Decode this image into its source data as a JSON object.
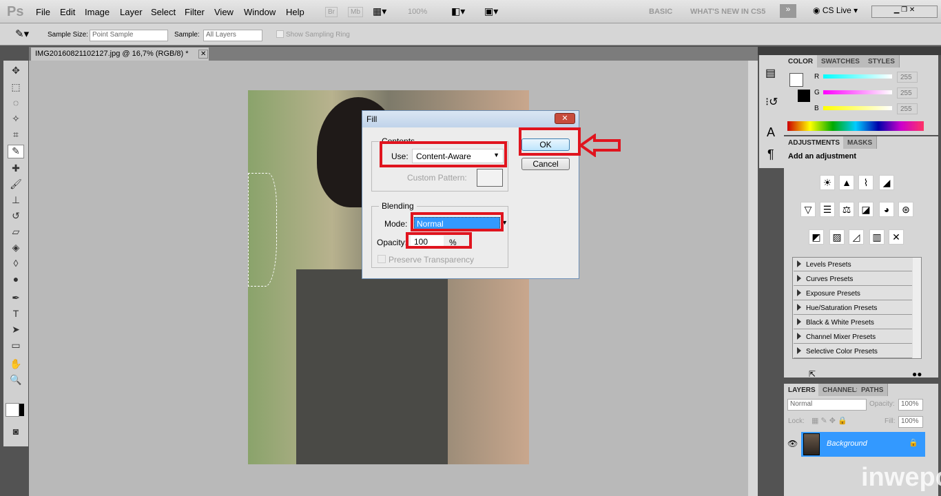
{
  "app": {
    "logo": "Ps",
    "menus": [
      "File",
      "Edit",
      "Image",
      "Layer",
      "Select",
      "Filter",
      "View",
      "Window",
      "Help"
    ],
    "bridge": "Br",
    "minibridge": "Mb",
    "zoom": "100%",
    "workspace_basic": "BASIC",
    "workspace_new": "WHAT'S NEW IN CS5",
    "cslive": "CS Live"
  },
  "options": {
    "sample_size_label": "Sample Size:",
    "sample_size": "Point Sample",
    "sample_label": "Sample:",
    "sample": "All Layers",
    "show_ring": "Show Sampling Ring"
  },
  "document": {
    "tab": "IMG20160821102127.jpg @ 16,7% (RGB/8) *"
  },
  "dialog": {
    "title": "Fill",
    "contents_legend": "Contents",
    "use_label": "Use:",
    "use_value": "Content-Aware",
    "custom_pattern": "Custom Pattern:",
    "blending_legend": "Blending",
    "mode_label": "Mode:",
    "mode_value": "Normal",
    "opacity_label": "Opacity:",
    "opacity_value": "100",
    "opacity_unit": "%",
    "preserve": "Preserve Transparency",
    "ok": "OK",
    "cancel": "Cancel",
    "highlight_color": "#e0141e"
  },
  "color_panel": {
    "tabs": [
      "COLOR",
      "SWATCHES",
      "STYLES"
    ],
    "r_label": "R",
    "g_label": "G",
    "b_label": "B",
    "r": "255",
    "g": "255",
    "b": "255"
  },
  "adjustments": {
    "tabs": [
      "ADJUSTMENTS",
      "MASKS"
    ],
    "heading": "Add an adjustment",
    "presets": [
      "Levels Presets",
      "Curves Presets",
      "Exposure Presets",
      "Hue/Saturation Presets",
      "Black & White Presets",
      "Channel Mixer Presets",
      "Selective Color Presets"
    ]
  },
  "layers": {
    "tabs": [
      "LAYERS",
      "CHANNELS",
      "PATHS"
    ],
    "blend": "Normal",
    "opacity_label": "Opacity:",
    "opacity": "100%",
    "lock_label": "Lock:",
    "fill_label": "Fill:",
    "fill": "100%",
    "layer_name": "Background",
    "selected_color": "#3399ff"
  },
  "watermark": "inwepo"
}
